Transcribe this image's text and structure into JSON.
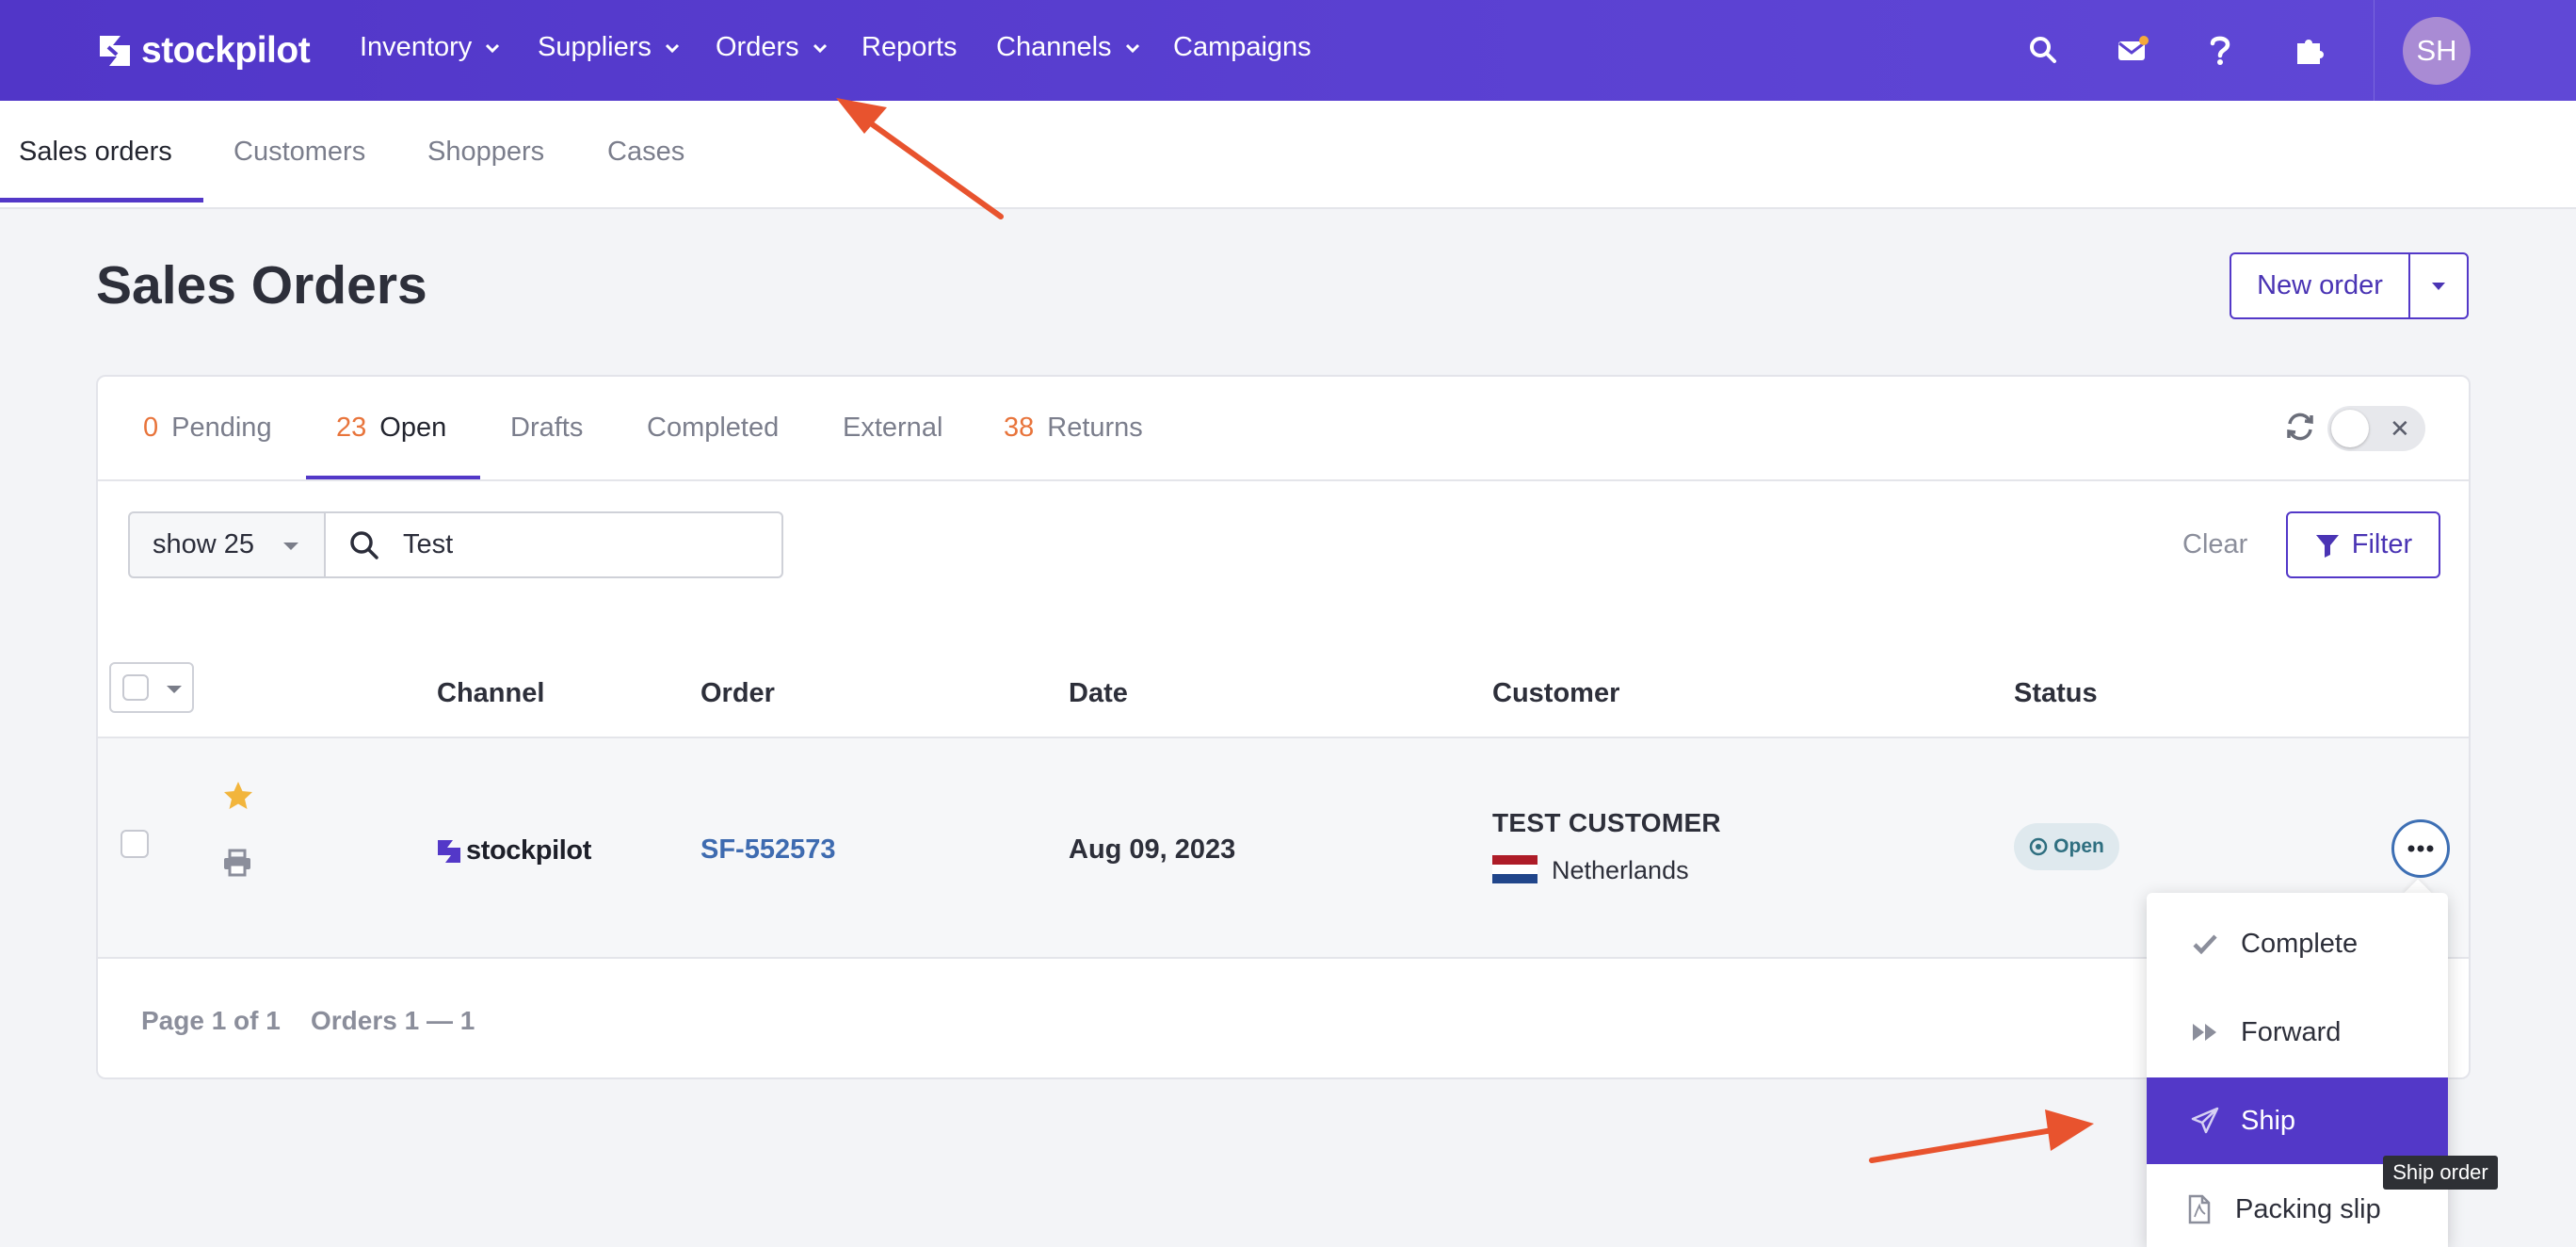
{
  "brand": {
    "name": "stockpilot"
  },
  "topnav": {
    "items": [
      {
        "label": "Inventory",
        "has_dropdown": true
      },
      {
        "label": "Suppliers",
        "has_dropdown": true
      },
      {
        "label": "Orders",
        "has_dropdown": true
      },
      {
        "label": "Reports",
        "has_dropdown": false
      },
      {
        "label": "Channels",
        "has_dropdown": true
      },
      {
        "label": "Campaigns",
        "has_dropdown": false
      }
    ],
    "icons": [
      "search-icon",
      "mail-icon",
      "help-icon",
      "puzzle-icon"
    ],
    "avatar_initials": "SH"
  },
  "subnav": {
    "tabs": [
      {
        "label": "Sales orders",
        "active": true
      },
      {
        "label": "Customers",
        "active": false
      },
      {
        "label": "Shoppers",
        "active": false
      },
      {
        "label": "Cases",
        "active": false
      }
    ]
  },
  "page": {
    "title": "Sales Orders",
    "new_order_label": "New order"
  },
  "order_tabs": [
    {
      "count": "0",
      "label": "Pending",
      "active": false
    },
    {
      "count": "23",
      "label": "Open",
      "active": true
    },
    {
      "count": "",
      "label": "Drafts",
      "active": false
    },
    {
      "count": "",
      "label": "Completed",
      "active": false
    },
    {
      "count": "",
      "label": "External",
      "active": false
    },
    {
      "count": "38",
      "label": "Returns",
      "active": false
    }
  ],
  "filters": {
    "page_size": "show 25",
    "search_value": "Test",
    "clear_label": "Clear",
    "filter_label": "Filter"
  },
  "table": {
    "columns": [
      "Channel",
      "Order",
      "Date",
      "Customer",
      "Status"
    ],
    "rows": [
      {
        "channel": "stockpilot",
        "order": "SF-552573",
        "date": "Aug 09, 2023",
        "customer": "TEST CUSTOMER",
        "country": "Netherlands",
        "status": "Open",
        "starred": true
      }
    ]
  },
  "footer": {
    "page_info": "Page 1 of 1",
    "orders_info": "Orders 1 — 1"
  },
  "row_menu": {
    "items": [
      {
        "label": "Complete",
        "icon": "check-icon"
      },
      {
        "label": "Forward",
        "icon": "fast-forward-icon"
      },
      {
        "label": "Ship",
        "icon": "paper-plane-icon",
        "active": true
      },
      {
        "label": "Packing slip",
        "icon": "pdf-file-icon"
      }
    ],
    "tooltip": "Ship order"
  },
  "colors": {
    "brand": "#5338c8",
    "accent_count": "#e8743b",
    "annotation_arrow": "#e8532e",
    "link": "#3e6bb0"
  }
}
